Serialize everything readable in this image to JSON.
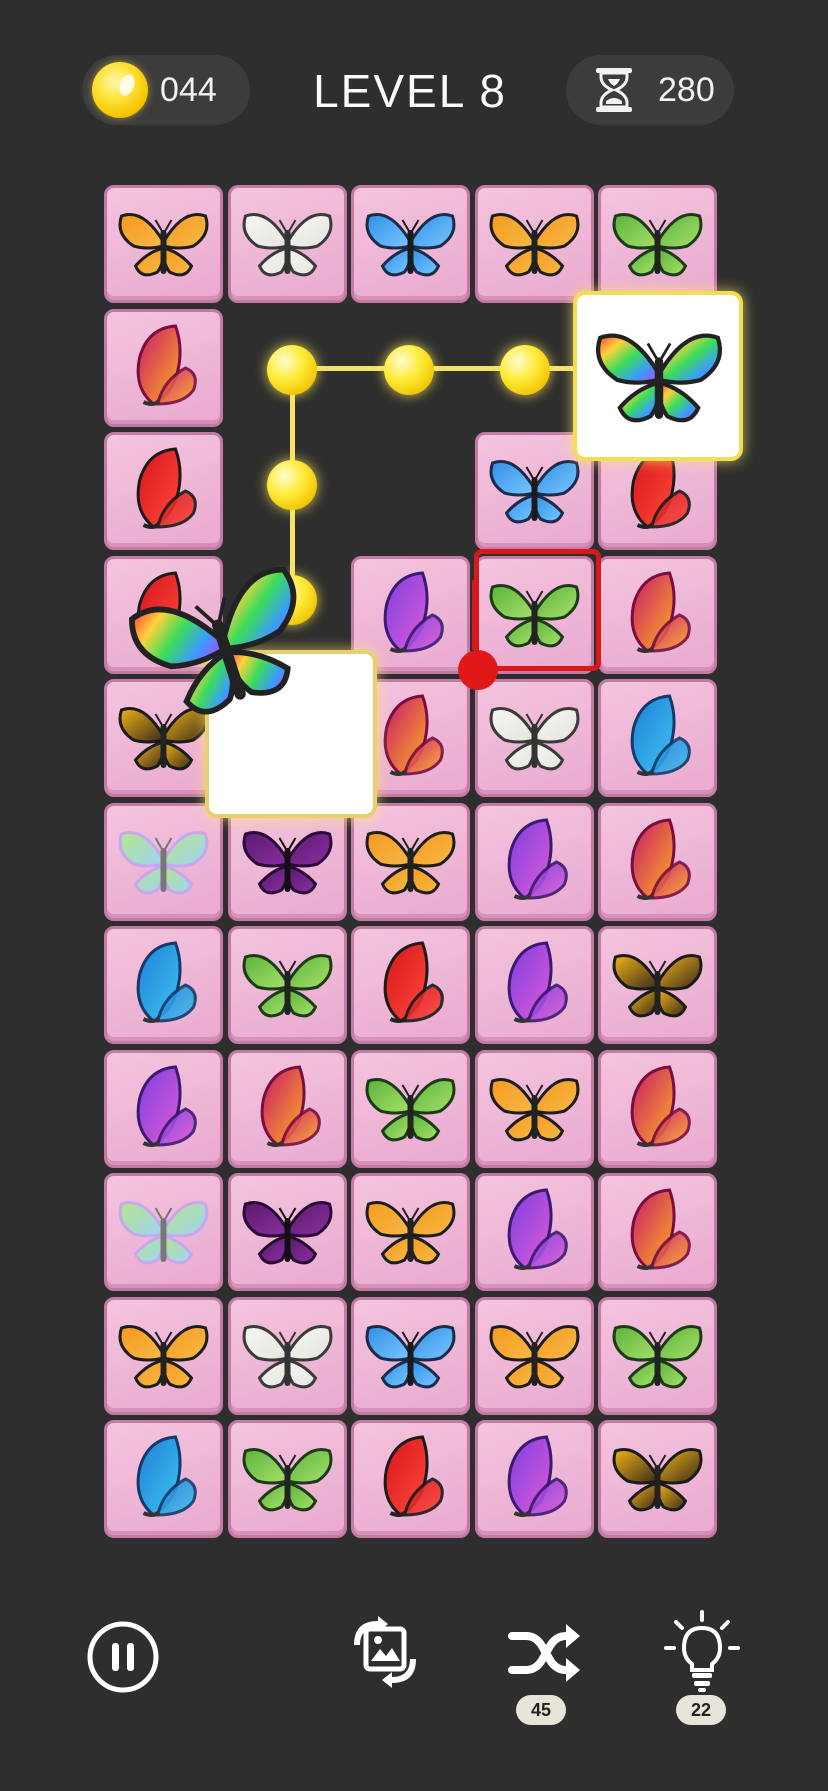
{
  "header": {
    "coins": "044",
    "level_title": "LEVEL 8",
    "timer": "280",
    "coin_icon": "coin-icon",
    "timer_icon": "hourglass-icon"
  },
  "board": {
    "rows": 11,
    "cols": 5,
    "tiles": [
      [
        "monarch",
        "white",
        "blue-morpho",
        "monarch",
        "green"
      ],
      [
        "pink-side",
        "",
        "",
        "",
        ""
      ],
      [
        "red",
        "",
        "",
        "blue-morpho",
        "red"
      ],
      [
        "red",
        "",
        "purple-side",
        "green",
        "pink-side"
      ],
      [
        "yellow-black",
        "",
        "pink-side",
        "white",
        "blue-side"
      ],
      [
        "pastel",
        "dark-purple",
        "monarch",
        "purple-side",
        "pink-side"
      ],
      [
        "blue-side",
        "green",
        "red",
        "purple-side",
        "yellow-black"
      ],
      [
        "purple-side",
        "pink-side",
        "green",
        "monarch",
        "pink-side"
      ],
      [
        "pastel",
        "dark-purple",
        "monarch",
        "purple-side",
        "pink-side"
      ],
      [
        "monarch",
        "white",
        "blue-morpho",
        "monarch",
        "green"
      ],
      [
        "blue-side",
        "green",
        "red",
        "purple-side",
        "yellow-black"
      ]
    ],
    "matched_pair": "rainbow",
    "selected_tile": "green"
  },
  "toolbar": {
    "pause_icon": "pause-icon",
    "swap_icon": "swap-icon",
    "shuffle_icon": "shuffle-icon",
    "shuffle_count": "45",
    "hint_icon": "lightbulb-icon",
    "hint_count": "22"
  },
  "colors": {
    "background": "#2e2e2e",
    "tile_pink": "#f0bcd8",
    "path_yellow": "#f3e36a",
    "select_red": "#d7191c"
  }
}
